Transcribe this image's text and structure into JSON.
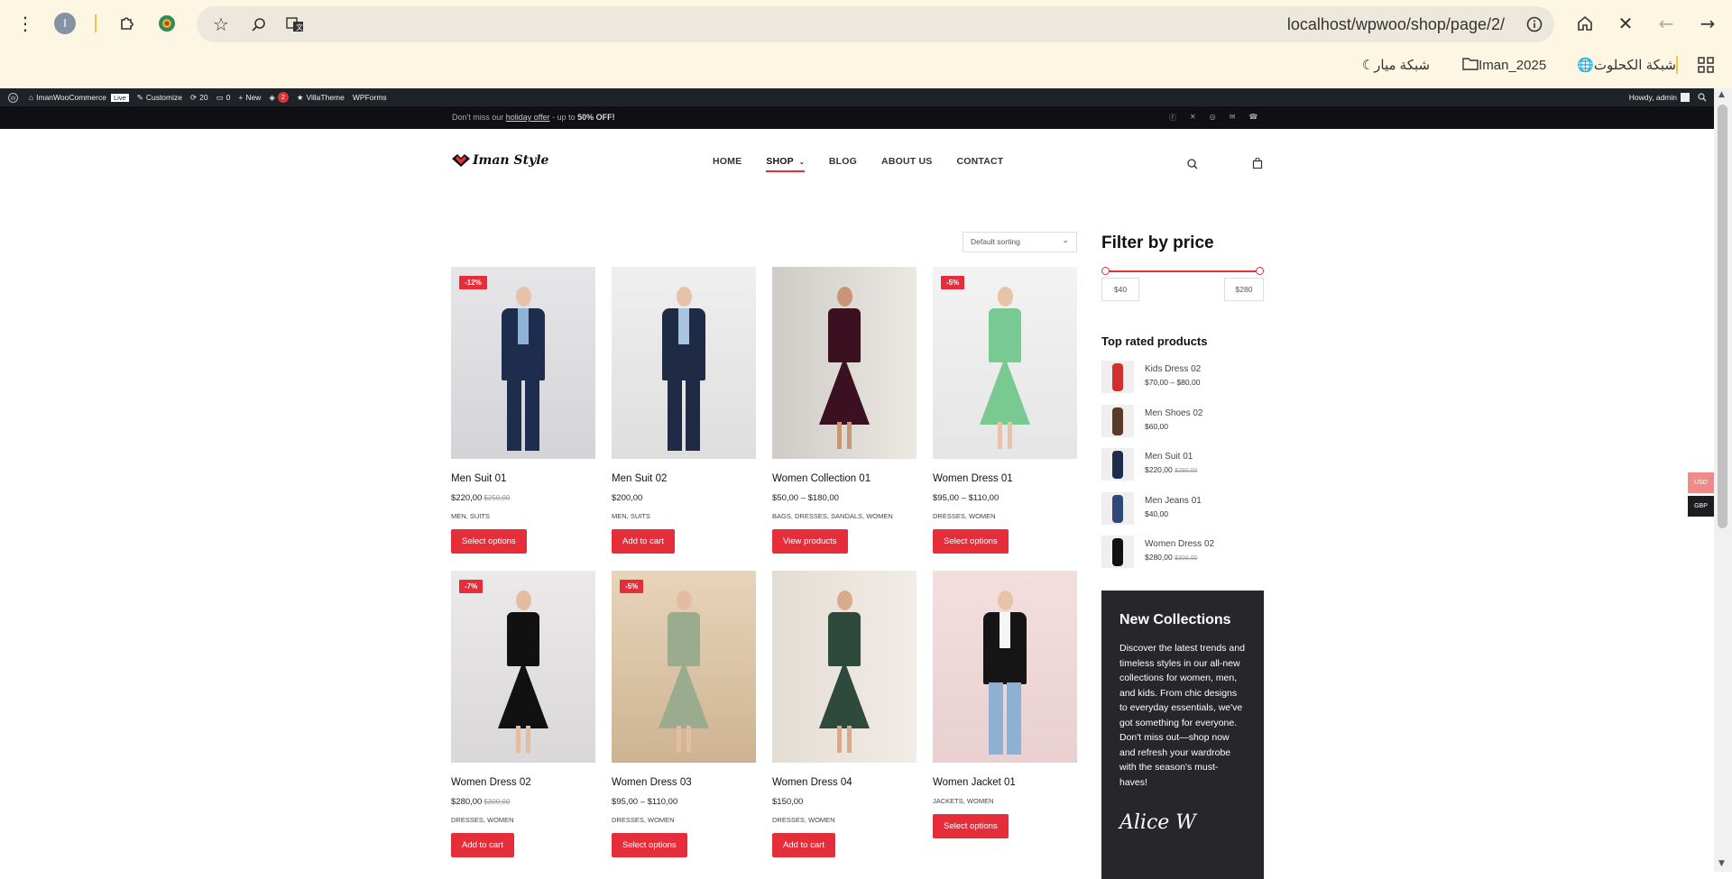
{
  "browser": {
    "url": "localhost/wpwoo/shop/page/2/",
    "profile_initial": "I",
    "bookmarks": [
      {
        "label": "شبكة الكحلوت"
      },
      {
        "label": "Iman_2025"
      },
      {
        "label": "شبكة ميار"
      }
    ]
  },
  "adminbar": {
    "site_name": "ImanWooCommerce",
    "live_badge": "Live",
    "customize": "Customize",
    "updates": "20",
    "comments": "0",
    "new": "New",
    "notif_count": "2",
    "villatheme": "VillaTheme",
    "wpforms": "WPForms",
    "howdy": "Howdy, admin"
  },
  "topbar": {
    "text_pre": "Don't miss our ",
    "link": "holiday offer",
    "text_mid": " - up to ",
    "bold": "50% OFF!"
  },
  "header": {
    "logo_text": "Iman Style",
    "nav": [
      "HOME",
      "SHOP",
      "BLOG",
      "ABOUT US",
      "CONTACT"
    ]
  },
  "sorting": {
    "selected": "Default sorting"
  },
  "products": [
    {
      "title": "Men Suit 01",
      "price": "$220,00",
      "old_price": "$250,00",
      "badge": "-12%",
      "cats": "MEN, SUITS",
      "button": "Select options",
      "img": "suit1"
    },
    {
      "title": "Men Suit 02",
      "price": "$200,00",
      "old_price": "",
      "badge": "",
      "cats": "MEN, SUITS",
      "button": "Add to cart",
      "img": "suit2"
    },
    {
      "title": "Women Collection 01",
      "price": "$50,00 – $180,00",
      "old_price": "",
      "badge": "",
      "cats": "BAGS, DRESSES, SANDALS, WOMEN",
      "button": "View products",
      "img": "coll1"
    },
    {
      "title": "Women Dress 01",
      "price": "$95,00 – $110,00",
      "old_price": "",
      "badge": "-5%",
      "cats": "DRESSES, WOMEN",
      "button": "Select options",
      "img": "dress1"
    },
    {
      "title": "Women Dress 02",
      "price": "$280,00",
      "old_price": "$300,00",
      "badge": "-7%",
      "cats": "DRESSES, WOMEN",
      "button": "Add to cart",
      "img": "dress2"
    },
    {
      "title": "Women Dress 03",
      "price": "$95,00 – $110,00",
      "old_price": "",
      "badge": "-5%",
      "cats": "DRESSES, WOMEN",
      "button": "Select options",
      "img": "dress3"
    },
    {
      "title": "Women Dress 04",
      "price": "$150,00",
      "old_price": "",
      "badge": "",
      "cats": "DRESSES, WOMEN",
      "button": "Add to cart",
      "img": "dress4"
    },
    {
      "title": "Women Jacket 01",
      "price": "",
      "old_price": "",
      "badge": "",
      "cats": "JACKETS, WOMEN",
      "button": "Select options",
      "img": "jacket1"
    }
  ],
  "filter": {
    "title": "Filter by price",
    "min": "$40",
    "max": "$280"
  },
  "top_rated": {
    "title": "Top rated products",
    "items": [
      {
        "name": "Kids Dress 02",
        "price": "$70,00 – $80,00",
        "old": ""
      },
      {
        "name": "Men Shoes 02",
        "price": "$60,00",
        "old": ""
      },
      {
        "name": "Men Suit 01",
        "price": "$220,00",
        "old": "$250,00"
      },
      {
        "name": "Men Jeans 01",
        "price": "$40,00",
        "old": ""
      },
      {
        "name": "Women Dress 02",
        "price": "$280,00",
        "old": "$300,00"
      }
    ]
  },
  "new_collections": {
    "title": "New Collections",
    "body": "Discover the latest trends and timeless styles in our all-new collections for women, men, and kids. From chic designs to everyday essentials, we've got something for everyone. Don't miss out—shop now and refresh your wardrobe with the season's must-haves!",
    "signature": "Alice W"
  },
  "currency": {
    "usd": "USD",
    "gbp": "GBP"
  },
  "colors": {
    "accent": "#e62e3b",
    "dark": "#101014",
    "panel": "#27262b"
  }
}
